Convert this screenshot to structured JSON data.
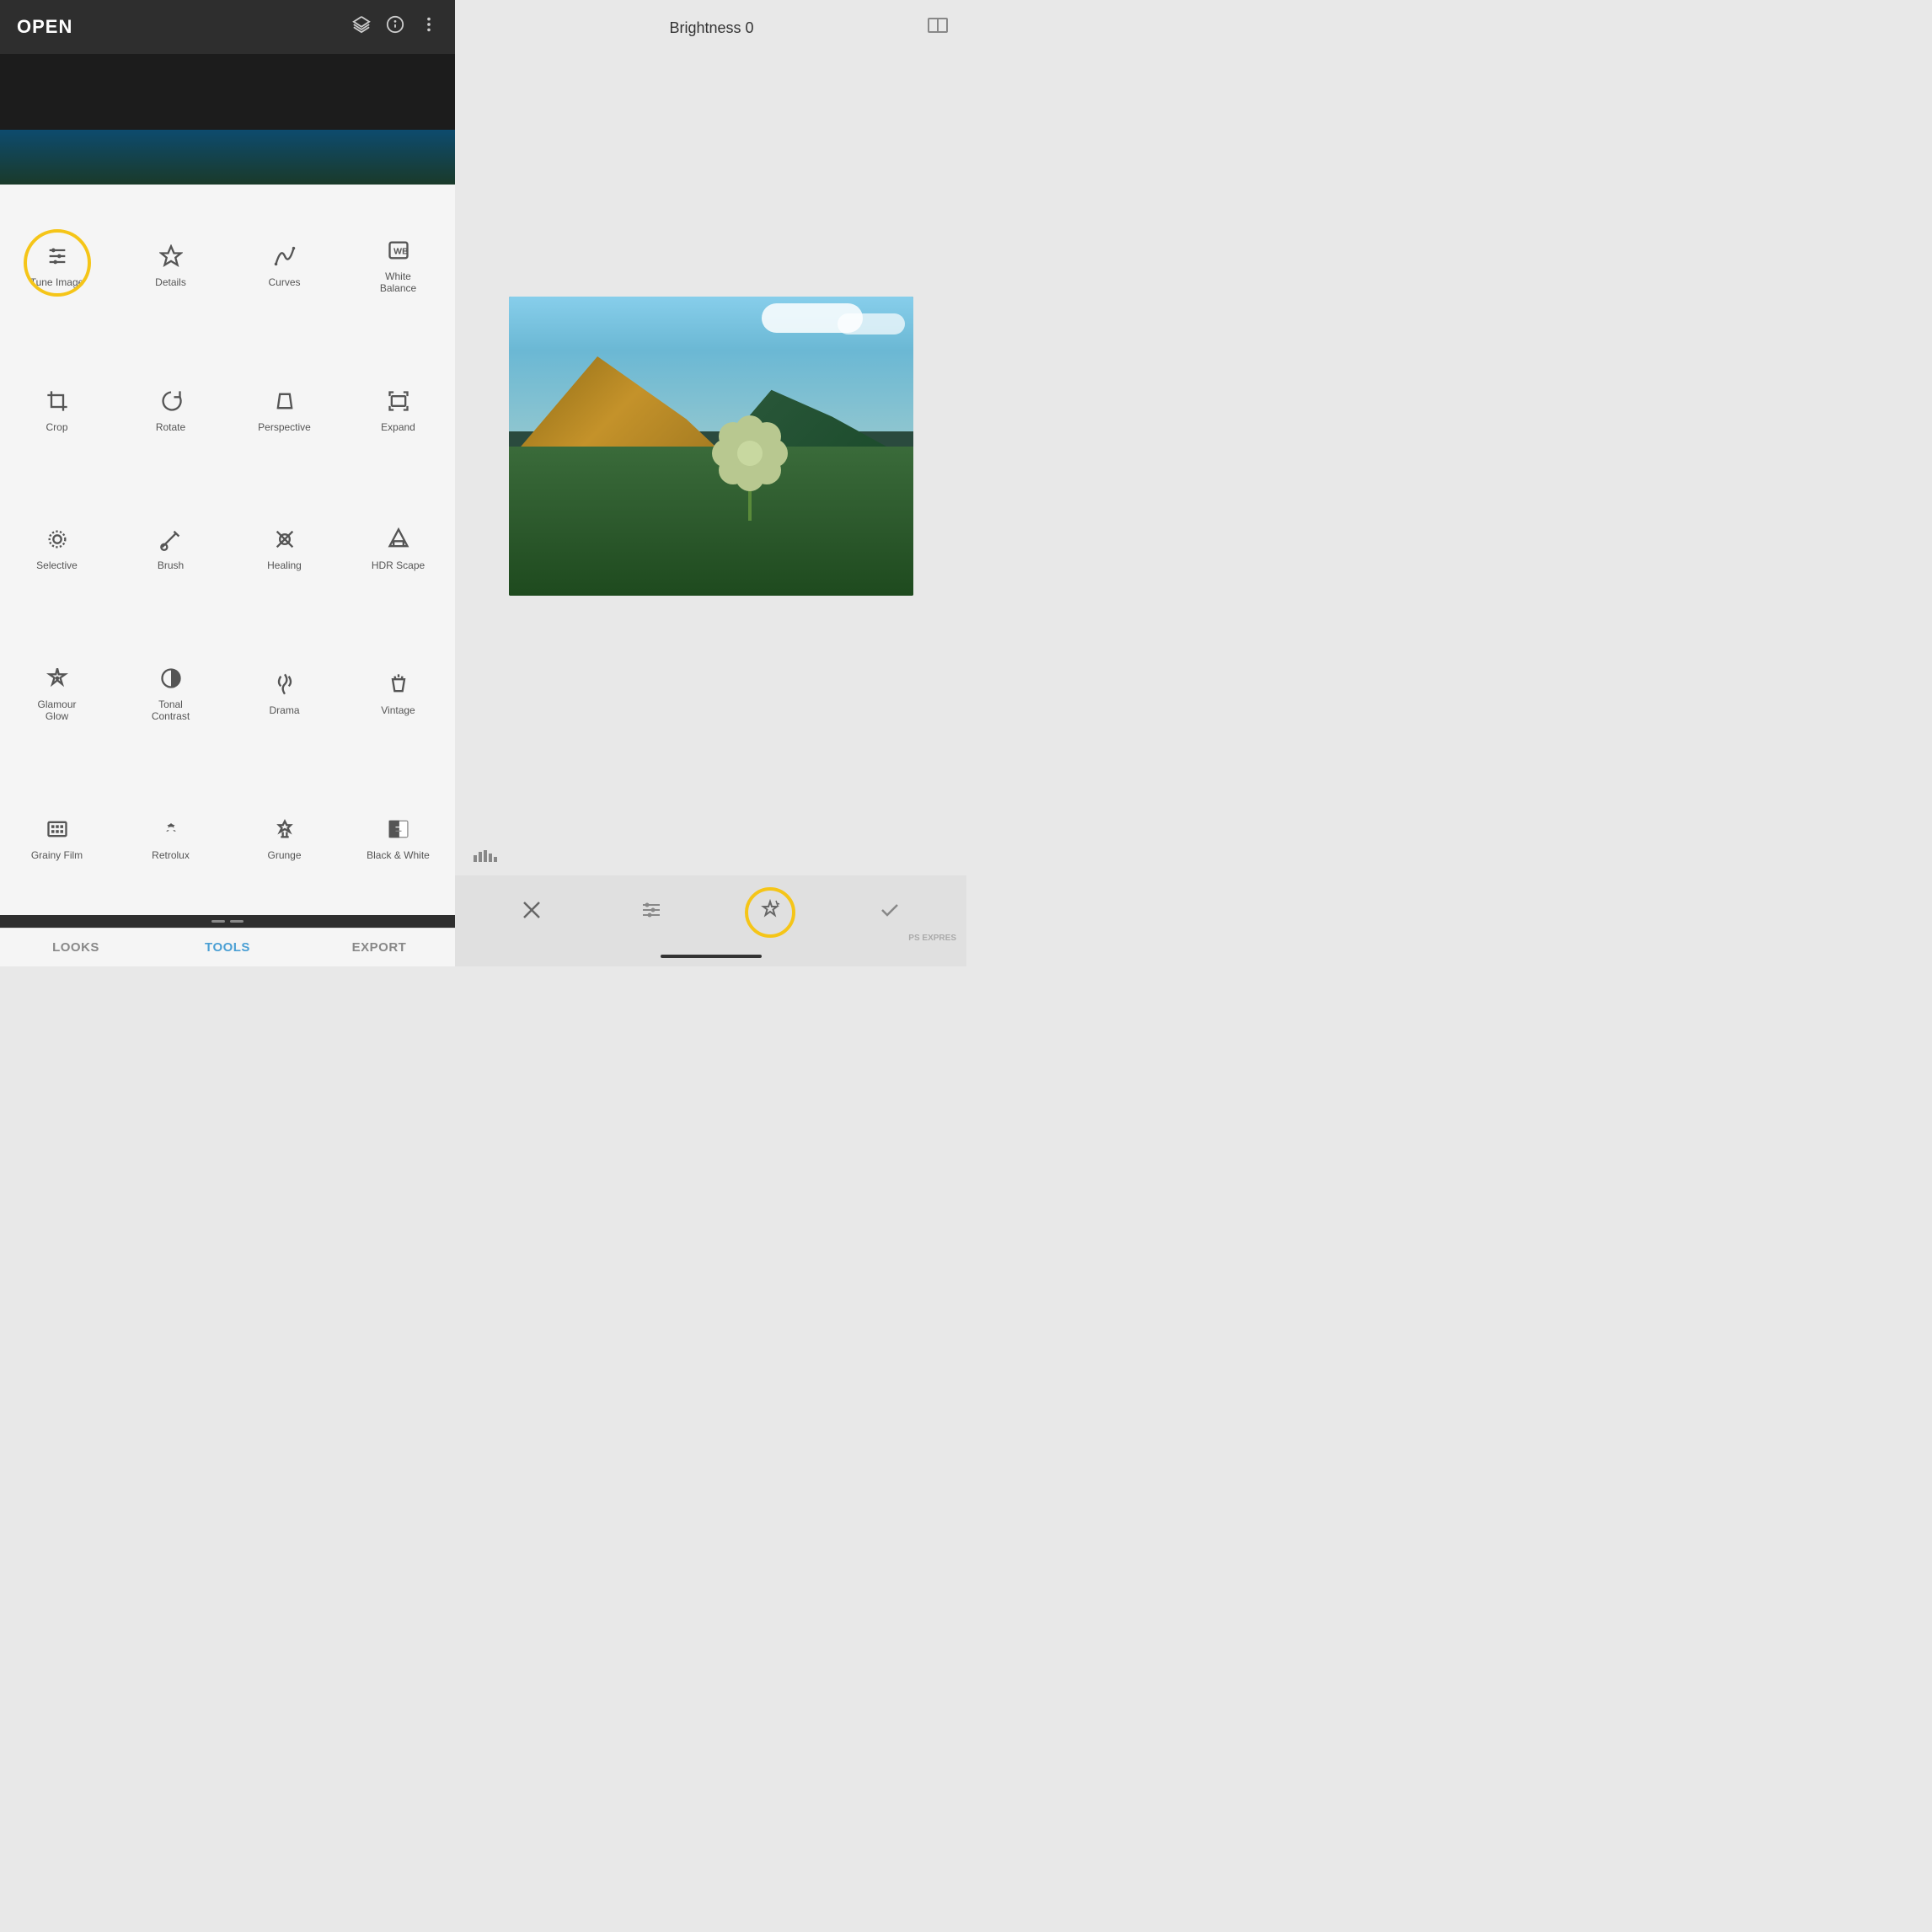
{
  "header": {
    "open_label": "OPEN",
    "brightness_title": "Brightness 0"
  },
  "tools": [
    {
      "id": "tune-image",
      "label": "Tune Image",
      "highlighted": true
    },
    {
      "id": "details",
      "label": "Details",
      "highlighted": false
    },
    {
      "id": "curves",
      "label": "Curves",
      "highlighted": false
    },
    {
      "id": "white-balance",
      "label": "White Balance",
      "highlighted": false
    },
    {
      "id": "crop",
      "label": "Crop",
      "highlighted": false
    },
    {
      "id": "rotate",
      "label": "Rotate",
      "highlighted": false
    },
    {
      "id": "perspective",
      "label": "Perspective",
      "highlighted": false
    },
    {
      "id": "expand",
      "label": "Expand",
      "highlighted": false
    },
    {
      "id": "selective",
      "label": "Selective",
      "highlighted": false
    },
    {
      "id": "brush",
      "label": "Brush",
      "highlighted": false
    },
    {
      "id": "healing",
      "label": "Healing",
      "highlighted": false
    },
    {
      "id": "hdr-scape",
      "label": "HDR Scape",
      "highlighted": false
    },
    {
      "id": "glamour-glow",
      "label": "Glamour Glow",
      "highlighted": false
    },
    {
      "id": "tonal-contrast",
      "label": "Tonal Contrast",
      "highlighted": false
    },
    {
      "id": "drama",
      "label": "Drama",
      "highlighted": false
    },
    {
      "id": "vintage",
      "label": "Vintage",
      "highlighted": false
    },
    {
      "id": "grainy-film",
      "label": "Grainy Film",
      "highlighted": false
    },
    {
      "id": "retrolux",
      "label": "Retrolux",
      "highlighted": false
    },
    {
      "id": "grunge",
      "label": "Grunge",
      "highlighted": false
    },
    {
      "id": "black-white",
      "label": "Black & White",
      "highlighted": false
    }
  ],
  "bottom_nav": {
    "looks_label": "LOOKS",
    "tools_label": "TOOLS",
    "export_label": "EXPORT",
    "active_tab": "TOOLS"
  },
  "colors": {
    "accent_yellow": "#f5c518",
    "active_blue": "#4a9fd4",
    "icon_color": "#555555",
    "bg_dark": "#2e2e2e",
    "bg_light": "#f5f5f5",
    "right_bg": "#e8e8e8"
  },
  "watermark": "PS EXPRES"
}
